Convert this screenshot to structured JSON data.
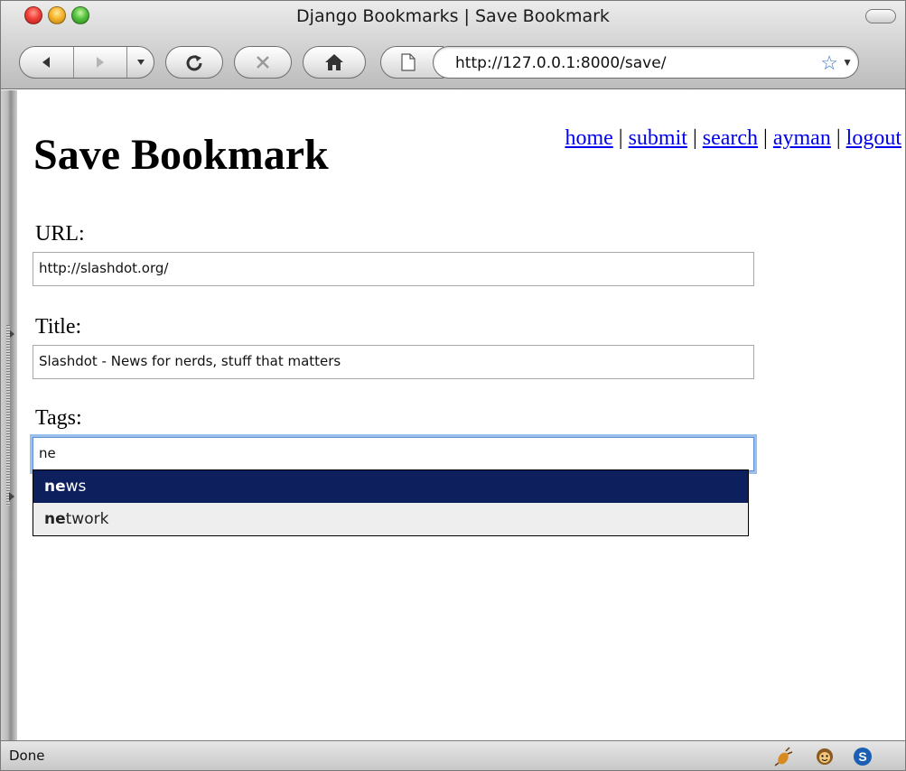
{
  "window": {
    "title": "Django Bookmarks | Save Bookmark"
  },
  "toolbar": {
    "address": "http://127.0.0.1:8000/save/"
  },
  "page": {
    "heading": "Save Bookmark",
    "nav": [
      {
        "label": "home"
      },
      {
        "label": "submit"
      },
      {
        "label": "search"
      },
      {
        "label": "ayman"
      },
      {
        "label": "logout"
      }
    ],
    "separator": "|",
    "form": {
      "url_label": "URL:",
      "url_value": "http://slashdot.org/",
      "title_label": "Title:",
      "title_value": "Slashdot - News for nerds, stuff that matters",
      "tags_label": "Tags:",
      "tags_value": "ne"
    },
    "autocomplete": {
      "items": [
        {
          "match": "ne",
          "rest": "ws",
          "selected": true
        },
        {
          "match": "ne",
          "rest": "twork",
          "selected": false
        }
      ]
    }
  },
  "status": {
    "text": "Done"
  },
  "icons": [
    "back-icon",
    "forward-icon",
    "history-dropdown-icon",
    "reload-icon",
    "stop-icon",
    "home-icon",
    "page-icon",
    "bookmark-star-icon",
    "firebug-icon",
    "greasemonkey-icon",
    "stumble-icon"
  ],
  "colors": {
    "link": "#0000ee",
    "selection": "#0d1f5c",
    "focus_ring": "#9cc0ec"
  }
}
